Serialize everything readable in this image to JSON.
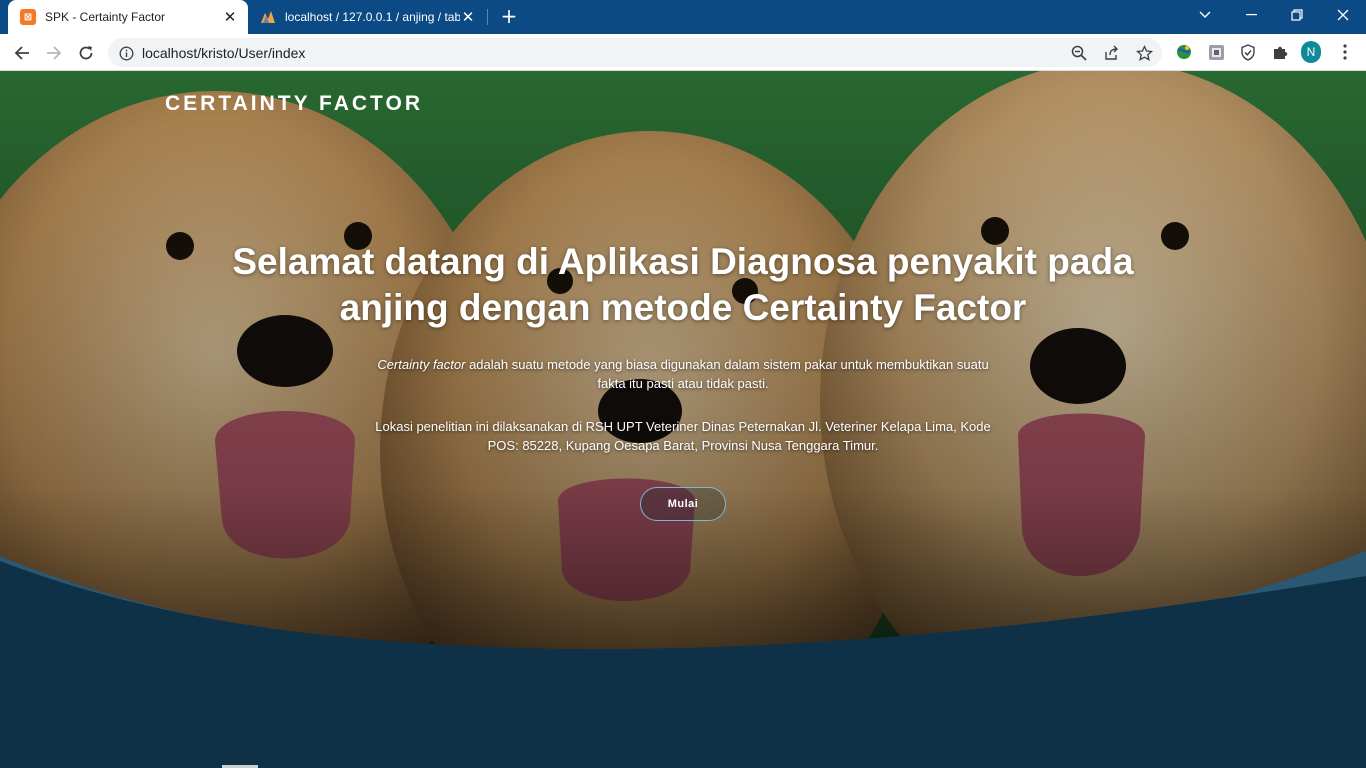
{
  "browser": {
    "tabs": [
      {
        "title": "SPK - Certainty Factor",
        "active": true,
        "favicon": "xampp-icon"
      },
      {
        "title": "localhost / 127.0.0.1 / anjing / tab",
        "active": false,
        "favicon": "phpmyadmin-icon"
      }
    ],
    "url": "localhost/kristo/User/index",
    "profile_initial": "N",
    "colors": {
      "tabbar": "#0c4a85",
      "toolbar": "#ffffff",
      "profile": "#0f8a9a"
    }
  },
  "page": {
    "brand": "CERTAINTY FACTOR",
    "headline": "Selamat datang di Aplikasi Diagnosa penyakit pada anjing dengan metode Certainty Factor",
    "intro_italic": "Certainty factor",
    "intro_rest": " adalah suatu metode yang biasa digunakan dalam sistem pakar untuk membuktikan suatu fakta itu pasti atau tidak pasti.",
    "location_text": "Lokasi penelitian ini dilaksanakan di RSH UPT Veteriner Dinas Peternakan Jl. Veteriner Kelapa Lima, Kode POS: 85228, Kupang Oesapa Barat, Provinsi Nusa Tenggara Timur.",
    "button_label": "Mulai",
    "colors": {
      "wave_dark": "#0f3147",
      "wave_light": "#2a5872",
      "button_border": "#7fb6cf"
    }
  }
}
